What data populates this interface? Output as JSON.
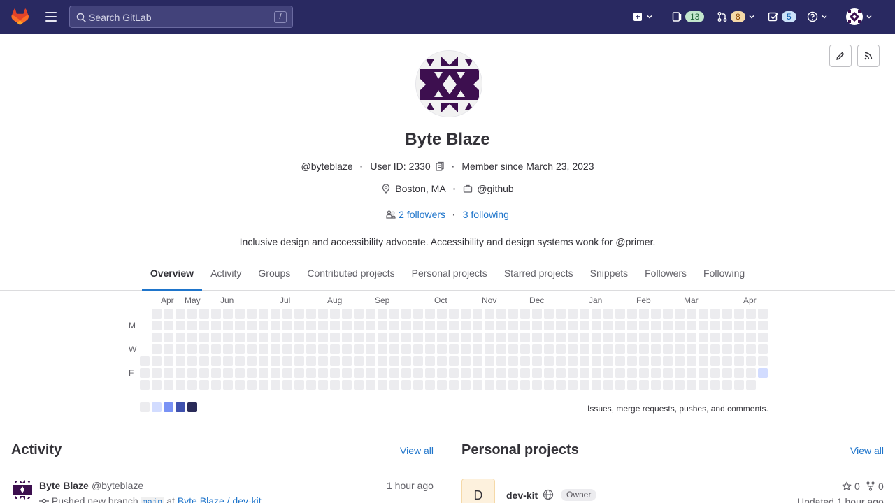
{
  "topbar": {
    "search_placeholder": "Search GitLab",
    "search_shortcut": "/",
    "issues_count": "13",
    "merge_requests_count": "8",
    "todos_count": "5"
  },
  "profile": {
    "name": "Byte Blaze",
    "username": "@byteblaze",
    "user_id_label": "User ID: 2330",
    "member_since": "Member since March 23, 2023",
    "location": "Boston, MA",
    "organization": "@github",
    "followers": "2 followers",
    "following": "3 following",
    "bio": "Inclusive design and accessibility advocate. Accessibility and design systems wonk for @primer."
  },
  "tabs": [
    {
      "label": "Overview",
      "active": true
    },
    {
      "label": "Activity"
    },
    {
      "label": "Groups"
    },
    {
      "label": "Contributed projects"
    },
    {
      "label": "Personal projects"
    },
    {
      "label": "Starred projects"
    },
    {
      "label": "Snippets"
    },
    {
      "label": "Followers"
    },
    {
      "label": "Following"
    }
  ],
  "calendar": {
    "months": [
      "Apr",
      "May",
      "Jun",
      "Jul",
      "Aug",
      "Sep",
      "Oct",
      "Nov",
      "Dec",
      "Jan",
      "Feb",
      "Mar",
      "Apr"
    ],
    "day_labels": [
      "",
      "M",
      "",
      "W",
      "",
      "F",
      ""
    ],
    "footer_text": "Issues, merge requests, pushes, and comments.",
    "legend_colors": [
      "#ececef",
      "#d2dcff",
      "#7992f5",
      "#3f51ae",
      "#2a2b59"
    ],
    "empty_color": "#ececef",
    "active_color": "#d2dcff"
  },
  "activity": {
    "title": "Activity",
    "view_all": "View all",
    "item": {
      "author": "Byte Blaze",
      "handle": "@byteblaze",
      "time": "1 hour ago",
      "action": "Pushed new branch",
      "branch": "main",
      "at": "at",
      "project": "Byte Blaze / dev-kit"
    }
  },
  "personal_projects": {
    "title": "Personal projects",
    "view_all": "View all",
    "item": {
      "initial": "D",
      "name": "dev-kit",
      "role": "Owner",
      "stars": "0",
      "forks": "0",
      "updated": "Updated 1 hour ago"
    }
  },
  "colors": {
    "topbar": "#292961",
    "link": "#1f75cb",
    "avatar_purple": "#3d0f4f"
  }
}
